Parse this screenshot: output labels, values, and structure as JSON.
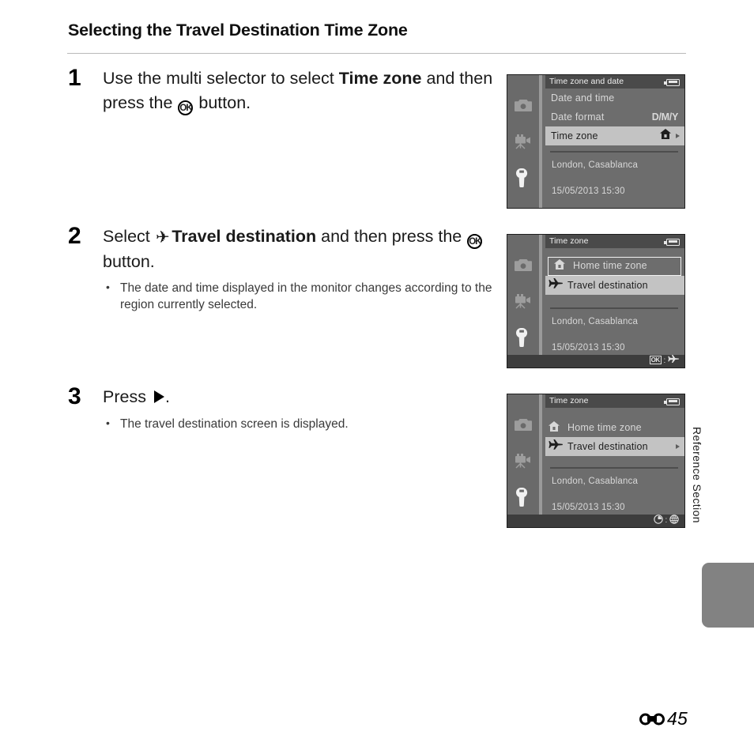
{
  "page": {
    "heading": "Selecting the Travel Destination Time Zone",
    "side_label": "Reference Section",
    "page_number": "45",
    "page_mark_icon": "reference-section-icon"
  },
  "steps": [
    {
      "number": "1",
      "text_parts": {
        "a": "Use the multi selector to select ",
        "bold": "Time zone",
        "b": " and then press the ",
        "ok_icon": "OK",
        "c": " button."
      },
      "bullets": []
    },
    {
      "number": "2",
      "text_parts": {
        "a": "Select ",
        "plane_icon": "✈",
        "bold": "Travel destination",
        "b": " and then press the ",
        "ok_icon": "OK",
        "c": " button."
      },
      "bullets": [
        "The date and time displayed in the monitor changes according to the region currently selected."
      ]
    },
    {
      "number": "3",
      "text_parts": {
        "a": "Press ",
        "right_icon": "▶",
        "c": "."
      },
      "bullets": [
        "The travel destination screen is displayed."
      ]
    }
  ],
  "screens": [
    {
      "title": "Time zone and date",
      "battery_icon": "battery-icon",
      "rail": [
        {
          "icon": "camera-icon",
          "active": false
        },
        {
          "icon": "movie-camera-icon",
          "active": false
        },
        {
          "icon": "wrench-icon",
          "active": true
        }
      ],
      "rows": [
        {
          "label": "Date and time",
          "state": "normal",
          "value": "",
          "lead_icon": "",
          "arrow": false
        },
        {
          "label": "Date format",
          "state": "normal",
          "value": "D/M/Y",
          "lead_icon": "",
          "arrow": false
        },
        {
          "label": "Time zone",
          "state": "selected",
          "value": "",
          "lead_icon": "home-icon",
          "arrow": true
        }
      ],
      "info_location": "London, Casablanca",
      "info_datetime": "15/05/2013   15:30",
      "bottom_bar": {
        "show": false,
        "hint": ""
      }
    },
    {
      "title": "Time zone",
      "battery_icon": "battery-icon",
      "rail": [
        {
          "icon": "camera-icon",
          "active": false
        },
        {
          "icon": "movie-camera-icon",
          "active": false
        },
        {
          "icon": "wrench-icon",
          "active": true
        }
      ],
      "rows": [
        {
          "label": "Home time zone",
          "state": "cursor",
          "value": "",
          "lead_icon": "home-icon",
          "arrow": false
        },
        {
          "label": "Travel destination",
          "state": "selected",
          "value": "",
          "lead_icon": "plane-icon",
          "arrow": false
        }
      ],
      "info_location": "London, Casablanca",
      "info_datetime": "15/05/2013   15:30",
      "bottom_bar": {
        "show": true,
        "hint": "OK : ✈",
        "ok_label": "OK"
      }
    },
    {
      "title": "Time zone",
      "battery_icon": "battery-icon",
      "rail": [
        {
          "icon": "camera-icon",
          "active": false
        },
        {
          "icon": "movie-camera-icon",
          "active": false
        },
        {
          "icon": "wrench-icon",
          "active": true
        }
      ],
      "rows": [
        {
          "label": "Home time zone",
          "state": "normal",
          "value": "",
          "lead_icon": "home-icon",
          "arrow": false
        },
        {
          "label": "Travel destination",
          "state": "selected",
          "value": "",
          "lead_icon": "plane-icon",
          "arrow": true
        }
      ],
      "info_location": "London, Casablanca",
      "info_datetime": "15/05/2013   15:30",
      "bottom_bar": {
        "show": true,
        "hint": "clock : globe",
        "clock_icon": "clock-icon",
        "globe_icon": "globe-icon"
      }
    }
  ]
}
